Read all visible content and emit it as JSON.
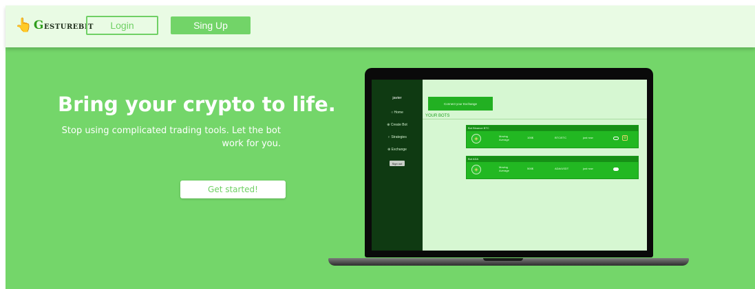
{
  "header": {
    "logo_icon": "pointing-hand-icon",
    "logo_initial": "G",
    "logo_rest": "ESTUREBIT",
    "login_label": "Login",
    "signup_label": "Sing Up"
  },
  "hero": {
    "title": "Bring your crypto to life.",
    "subtitle": "Stop using complicated trading tools. Let the bot work for you.",
    "cta_label": "Get started!"
  },
  "app_preview": {
    "sidebar": {
      "user": "javier",
      "items": [
        {
          "label": "Home",
          "icon": "home-icon",
          "glyph": "○"
        },
        {
          "label": "Create Bot",
          "icon": "plus-circle-icon",
          "glyph": "⊕"
        },
        {
          "label": "Strategies",
          "icon": "lightbulb-icon",
          "glyph": "♀"
        },
        {
          "label": "Exchange",
          "icon": "exchange-icon",
          "glyph": "⊛"
        }
      ],
      "signout_label": "Sign out"
    },
    "connect_label": "Connect your Exchange",
    "bots_heading": "YOUR BOTS",
    "bots": [
      {
        "name": "Bot Binance BTC",
        "strategy": "Moving Average",
        "amount": "100$",
        "pair": "BTC/ETC",
        "status": "just now",
        "active": false,
        "coin_icon": "binance-coin-icon"
      },
      {
        "name": "Bot ADA",
        "strategy": "Moving Average",
        "amount": "500$",
        "pair": "ADA/USDT",
        "status": "just now",
        "active": true,
        "coin_icon": "binance-coin-icon"
      }
    ]
  },
  "colors": {
    "nav_bg": "#e9fbe4",
    "hero_bg": "#74d66a",
    "accent": "#6fd064",
    "app_sidebar": "#0f3a12",
    "app_main": "#d6f7d2",
    "bot_card": "#22b822"
  }
}
